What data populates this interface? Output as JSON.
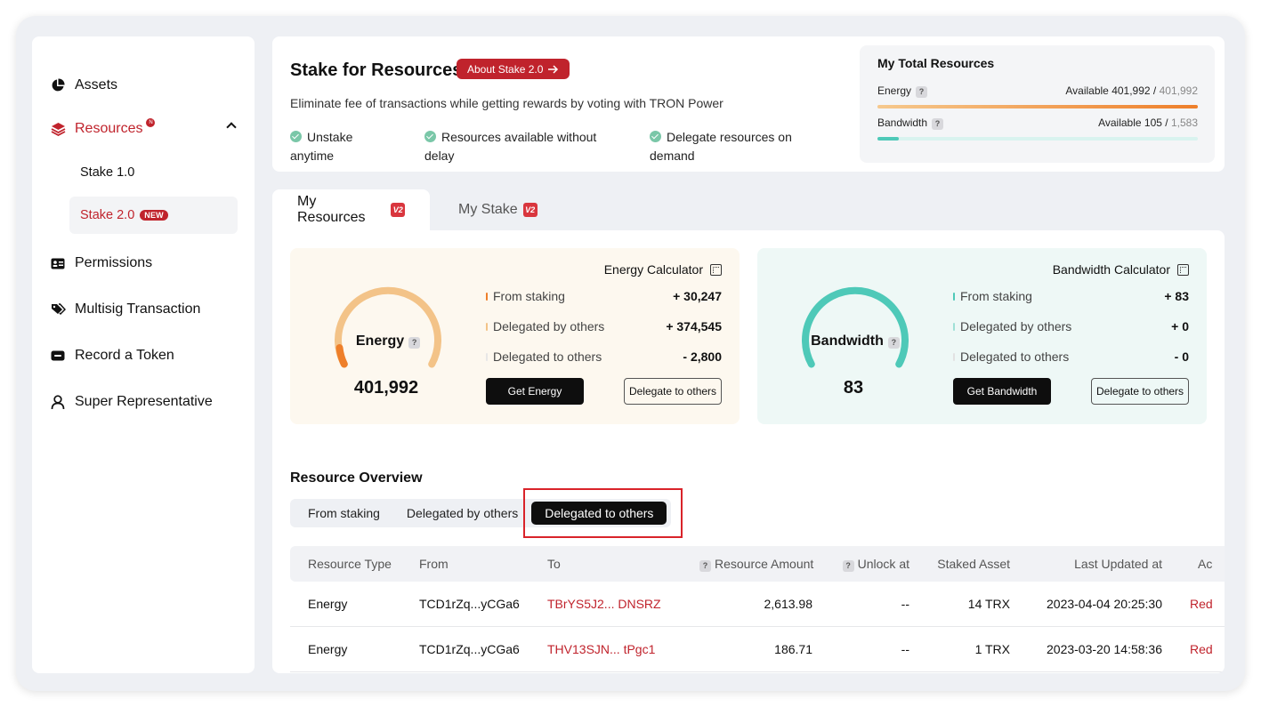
{
  "sidebar": {
    "items": [
      {
        "label": "Assets",
        "icon": "pie-chart-icon"
      },
      {
        "label": "Resources",
        "icon": "layers-icon"
      },
      {
        "label": "Permissions",
        "icon": "id-card-icon"
      },
      {
        "label": "Multisig Transaction",
        "icon": "tag-icon"
      },
      {
        "label": "Record a Token",
        "icon": "token-icon"
      },
      {
        "label": "Super Representative",
        "icon": "user-icon"
      }
    ],
    "subitems": [
      {
        "label": "Stake 1.0"
      },
      {
        "label": "Stake 2.0",
        "badge": "NEW"
      }
    ],
    "resources_dot": "N"
  },
  "header": {
    "title": "Stake for Resources",
    "about_label": "About Stake 2.0",
    "subtitle": "Eliminate fee of transactions while getting rewards by voting with TRON Power",
    "features": [
      {
        "line1": "Unstake",
        "line2": "anytime"
      },
      {
        "line1": "Resources available without",
        "line2": "delay"
      },
      {
        "line1": "Delegate resources on",
        "line2": "demand"
      }
    ]
  },
  "total": {
    "title": "My Total Resources",
    "energy": {
      "label": "Energy",
      "available_label": "Available",
      "available": "401,992",
      "total": "401,992",
      "fraction": 1.0
    },
    "bandwidth": {
      "label": "Bandwidth",
      "available_label": "Available",
      "available": "105",
      "total": "1,583",
      "fraction": 0.066
    }
  },
  "tabs": [
    {
      "label": "My Resources",
      "badge": "V2"
    },
    {
      "label": "My Stake",
      "badge": "V2"
    }
  ],
  "energy_card": {
    "calculator": "Energy Calculator",
    "label": "Energy",
    "value": "401,992",
    "stats": [
      {
        "label": "From staking",
        "value": "+ 30,247"
      },
      {
        "label": "Delegated by others",
        "value": "+ 374,545"
      },
      {
        "label": "Delegated to others",
        "value": "- 2,800"
      }
    ],
    "get_label": "Get Energy",
    "delegate_label": "Delegate to others",
    "accent": "#f0b97a"
  },
  "bandwidth_card": {
    "calculator": "Bandwidth Calculator",
    "label": "Bandwidth",
    "value": "83",
    "stats": [
      {
        "label": "From staking",
        "value": "+ 83"
      },
      {
        "label": "Delegated by others",
        "value": "+ 0"
      },
      {
        "label": "Delegated to others",
        "value": "- 0"
      }
    ],
    "get_label": "Get Bandwidth",
    "delegate_label": "Delegate to others",
    "accent": "#4ec9b8"
  },
  "overview": {
    "title": "Resource Overview",
    "segments": [
      "From staking",
      "Delegated by others",
      "Delegated to others"
    ],
    "active_segment": "Delegated to others",
    "columns": [
      "Resource Type",
      "From",
      "To",
      "Resource Amount",
      "Unlock at",
      "Staked Asset",
      "Last Updated at",
      "Ac"
    ],
    "rows": [
      {
        "type": "Energy",
        "from": "TCD1rZq...yCGa6",
        "to": "TBrYS5J2... DNSRZ",
        "amount": "2,613.98",
        "unlock": "--",
        "asset": "14 TRX",
        "updated": "2023-04-04 20:25:30",
        "action": "Red"
      },
      {
        "type": "Energy",
        "from": "TCD1rZq...yCGa6",
        "to": "THV13SJN... tPgc1",
        "amount": "186.71",
        "unlock": "--",
        "asset": "1 TRX",
        "updated": "2023-03-20 14:58:36",
        "action": "Red"
      }
    ]
  },
  "colors": {
    "brand": "#c0232c",
    "energy": "#f0b97a",
    "bandwidth": "#4ec9b8"
  }
}
